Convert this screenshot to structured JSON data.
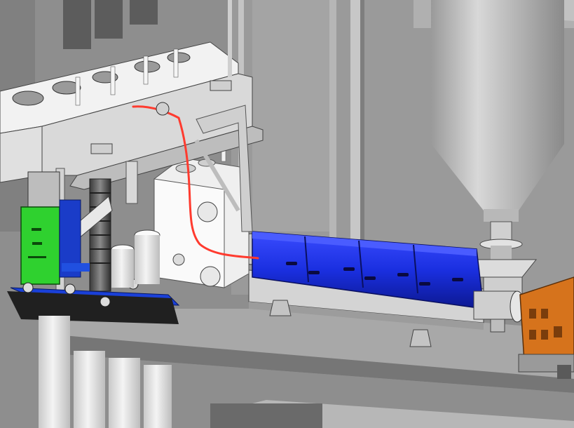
{
  "scene": {
    "kind": "3D CAD render of an extrusion line",
    "components": [
      "gearbox",
      "extruder-barrel",
      "heater-bands",
      "feed-hopper",
      "feed-throat",
      "die-block",
      "vacuum-sizing-tank",
      "puller-carriage",
      "pipe-rollers",
      "support-frame",
      "melt-line",
      "operator-platform"
    ]
  },
  "colors": {
    "background": "#8e8e8e",
    "wall": "#9c9c9c",
    "platform_top": "#a9a9a9",
    "platform_front": "#7c7c7c",
    "barrel_blue": "#1a2fe0",
    "barrel_blue_dark": "#0d1a9a",
    "gearbox_orange": "#d6731c",
    "puller_green": "#2fd12f",
    "melt_line_red": "#ff3b2f",
    "steel_light": "#e6e6e6",
    "steel_mid": "#bdbdbd",
    "steel_dark": "#6f6f6f"
  }
}
